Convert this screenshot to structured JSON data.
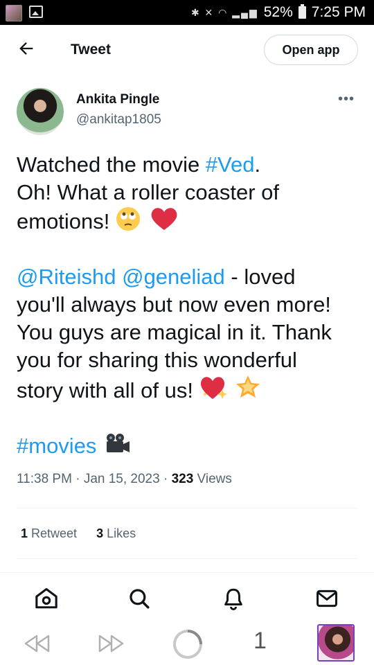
{
  "status_bar": {
    "battery": "52%",
    "time": "7:25 PM"
  },
  "header": {
    "title": "Tweet",
    "open_app": "Open app"
  },
  "author": {
    "name": "Ankita Pingle",
    "handle": "@ankitap1805"
  },
  "tweet": {
    "l1_a": "Watched the movie ",
    "l1_tag": "#Ved",
    "l1_b": ".",
    "l2": "Oh! What a roller coaster of",
    "l3": "emotions! ",
    "l5_m1": "@Riteishd",
    "l5_sp": " ",
    "l5_m2": "@geneliad",
    "l5_b": " - loved",
    "l6": "you'll always but now even more!",
    "l7": "You guys are magical in it. Thank",
    "l8": "you for sharing this wonderful",
    "l9": "story with all of us! ",
    "l11_tag": "#movies",
    "time": "11:38 PM",
    "sep": " · ",
    "date": "Jan 15, 2023",
    "views_count": "323",
    "views_label": " Views"
  },
  "engagement": {
    "retweet_count": "1",
    "retweet_label": " Retweet",
    "likes_count": "3",
    "likes_label": " Likes"
  },
  "browser": {
    "tab_count": "1"
  },
  "icons": {
    "back": "arrow-left-icon",
    "more": "more-dots-icon",
    "home": "home-icon",
    "search": "search-icon",
    "notifications": "bell-icon",
    "messages": "mail-icon",
    "browser_back": "rewind-icon",
    "browser_forward": "forward-icon",
    "loading": "loading-ring-icon"
  },
  "colors": {
    "link": "#1d9bf0",
    "text": "#0f1419",
    "secondary": "#536471"
  }
}
